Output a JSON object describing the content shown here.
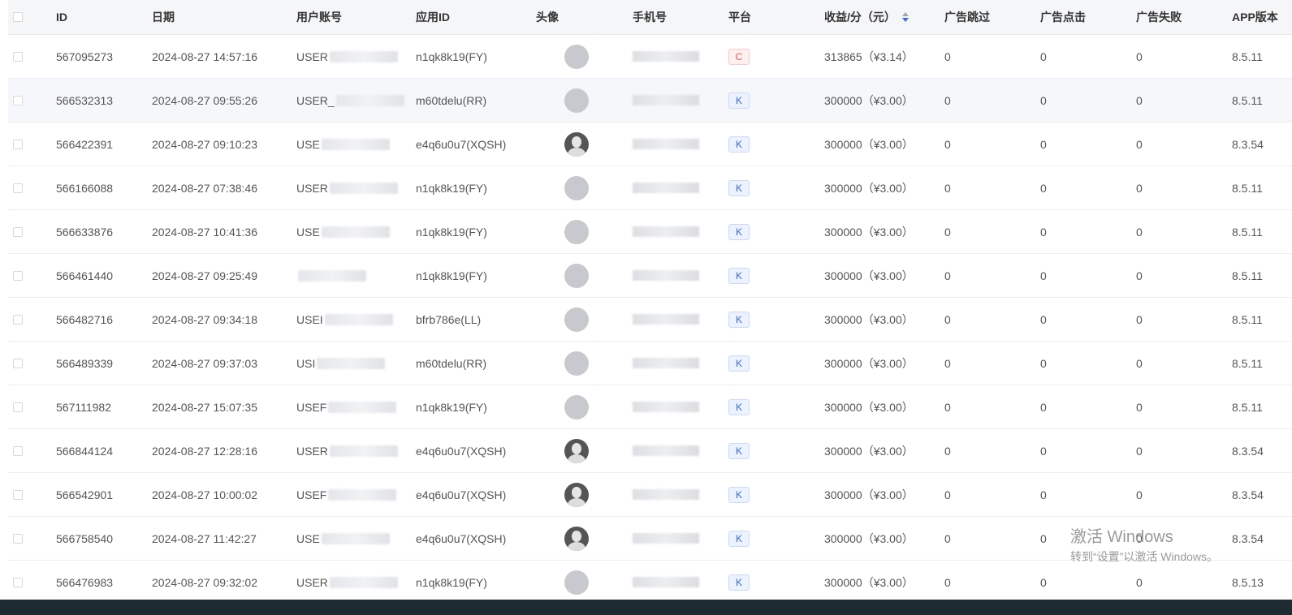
{
  "columns": {
    "id": "ID",
    "date": "日期",
    "account": "用户账号",
    "app_id": "应用ID",
    "avatar": "头像",
    "phone": "手机号",
    "platform": "平台",
    "income": "收益/分（元）",
    "ad_skip": "广告跳过",
    "ad_click": "广告点击",
    "ad_fail": "广告失败",
    "app_version": "APP版本"
  },
  "rows": [
    {
      "id": "567095273",
      "date": "2024-08-27 14:57:16",
      "account": "USER",
      "app_id": "n1qk8k19(FY)",
      "avatar": "grey",
      "platform": "C",
      "income": "313865（¥3.14）",
      "ad_skip": "0",
      "ad_click": "0",
      "ad_fail": "0",
      "version": "8.5.11"
    },
    {
      "id": "566532313",
      "date": "2024-08-27 09:55:26",
      "account": "USER_",
      "app_id": "m60tdelu(RR)",
      "avatar": "grey",
      "platform": "K",
      "income": "300000（¥3.00）",
      "ad_skip": "0",
      "ad_click": "0",
      "ad_fail": "0",
      "version": "8.5.11"
    },
    {
      "id": "566422391",
      "date": "2024-08-27 09:10:23",
      "account": "USE",
      "app_id": "e4q6u0u7(XQSH)",
      "avatar": "photo",
      "platform": "K",
      "income": "300000（¥3.00）",
      "ad_skip": "0",
      "ad_click": "0",
      "ad_fail": "0",
      "version": "8.3.54"
    },
    {
      "id": "566166088",
      "date": "2024-08-27 07:38:46",
      "account": "USER",
      "app_id": "n1qk8k19(FY)",
      "avatar": "grey",
      "platform": "K",
      "income": "300000（¥3.00）",
      "ad_skip": "0",
      "ad_click": "0",
      "ad_fail": "0",
      "version": "8.5.11"
    },
    {
      "id": "566633876",
      "date": "2024-08-27 10:41:36",
      "account": "USE",
      "app_id": "n1qk8k19(FY)",
      "avatar": "grey",
      "platform": "K",
      "income": "300000（¥3.00）",
      "ad_skip": "0",
      "ad_click": "0",
      "ad_fail": "0",
      "version": "8.5.11"
    },
    {
      "id": "566461440",
      "date": "2024-08-27 09:25:49",
      "account": "",
      "app_id": "n1qk8k19(FY)",
      "avatar": "grey",
      "platform": "K",
      "income": "300000（¥3.00）",
      "ad_skip": "0",
      "ad_click": "0",
      "ad_fail": "0",
      "version": "8.5.11"
    },
    {
      "id": "566482716",
      "date": "2024-08-27 09:34:18",
      "account": "USEI",
      "app_id": "bfrb786e(LL)",
      "avatar": "grey",
      "platform": "K",
      "income": "300000（¥3.00）",
      "ad_skip": "0",
      "ad_click": "0",
      "ad_fail": "0",
      "version": "8.5.11"
    },
    {
      "id": "566489339",
      "date": "2024-08-27 09:37:03",
      "account": "USI",
      "app_id": "m60tdelu(RR)",
      "avatar": "grey",
      "platform": "K",
      "income": "300000（¥3.00）",
      "ad_skip": "0",
      "ad_click": "0",
      "ad_fail": "0",
      "version": "8.5.11"
    },
    {
      "id": "567111982",
      "date": "2024-08-27 15:07:35",
      "account": "USEF",
      "app_id": "n1qk8k19(FY)",
      "avatar": "grey",
      "platform": "K",
      "income": "300000（¥3.00）",
      "ad_skip": "0",
      "ad_click": "0",
      "ad_fail": "0",
      "version": "8.5.11"
    },
    {
      "id": "566844124",
      "date": "2024-08-27 12:28:16",
      "account": "USER",
      "app_id": "e4q6u0u7(XQSH)",
      "avatar": "photo",
      "platform": "K",
      "income": "300000（¥3.00）",
      "ad_skip": "0",
      "ad_click": "0",
      "ad_fail": "0",
      "version": "8.3.54"
    },
    {
      "id": "566542901",
      "date": "2024-08-27 10:00:02",
      "account": "USEF",
      "app_id": "e4q6u0u7(XQSH)",
      "avatar": "photo",
      "platform": "K",
      "income": "300000（¥3.00）",
      "ad_skip": "0",
      "ad_click": "0",
      "ad_fail": "0",
      "version": "8.3.54"
    },
    {
      "id": "566758540",
      "date": "2024-08-27 11:42:27",
      "account": "USE",
      "app_id": "e4q6u0u7(XQSH)",
      "avatar": "photo",
      "platform": "K",
      "income": "300000（¥3.00）",
      "ad_skip": "0",
      "ad_click": "0",
      "ad_fail": "0",
      "version": "8.3.54"
    },
    {
      "id": "566476983",
      "date": "2024-08-27 09:32:02",
      "account": "USER",
      "app_id": "n1qk8k19(FY)",
      "avatar": "grey",
      "platform": "K",
      "income": "300000（¥3.00）",
      "ad_skip": "0",
      "ad_click": "0",
      "ad_fail": "0",
      "version": "8.5.13"
    }
  ],
  "watermark": {
    "line1": "激活 Windows",
    "line2": "转到“设置”以激活 Windows。"
  },
  "colors": {
    "tag_k_text": "#3b6bd9",
    "tag_c_text": "#e55555",
    "header_bg": "#f5f6f8"
  }
}
